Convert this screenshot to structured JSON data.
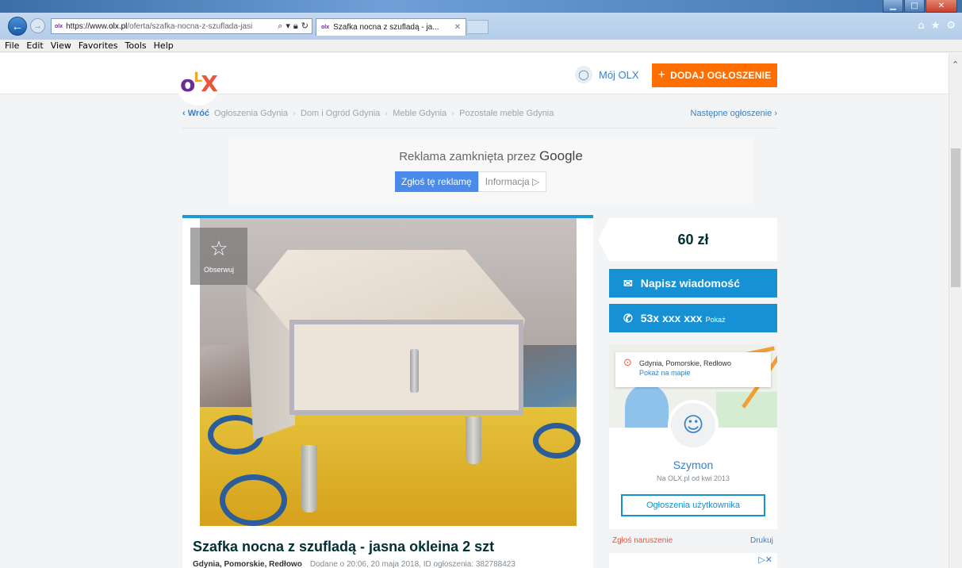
{
  "browser": {
    "url_prefix": "https://www.",
    "url_domain": "olx.pl",
    "url_rest": "/oferta/szafka-nocna-z-szuflada-jasi",
    "tab_title": "Szafka nocna z szufladą - ja...",
    "favicon_text": "olx",
    "menu": [
      "File",
      "Edit",
      "View",
      "Favorites",
      "Tools",
      "Help"
    ]
  },
  "header": {
    "my_olx": "Mój OLX",
    "add_button": "DODAJ OGŁOSZENIE"
  },
  "breadcrumb": {
    "back": "Wróć",
    "items": [
      "Ogłoszenia Gdynia",
      "Dom i Ogród Gdynia",
      "Meble Gdynia",
      "Pozostałe meble Gdynia"
    ],
    "next": "Następne ogłoszenie"
  },
  "ad_closed": {
    "message": "Reklama zamknięta przez",
    "brand": "Google",
    "report_button": "Zgłoś tę reklamę",
    "info_button": "Informacja ▷"
  },
  "listing": {
    "observe": "Obserwuj",
    "title": "Szafka nocna z szufladą - jasna okleina 2 szt",
    "location": "Gdynia, Pomorskie, Redłowo",
    "meta": "Dodane o 20:06, 20 maja 2018, ID ogłoszenia: 382788423"
  },
  "sidebar": {
    "price": "60 zł",
    "message_button": "Napisz wiadomość",
    "phone_number": "53x xxx xxx",
    "phone_show": "Pokaż",
    "map_location": "Gdynia, Pomorskie, Redłowo",
    "map_show": "Pokaż na mapie",
    "seller_name": "Szymon",
    "seller_since": "Na OLX.pl od kwi 2013",
    "user_ads_button": "Ogłoszenia użytkownika",
    "report": "Zgłoś naruszenie",
    "print": "Drukuj"
  },
  "colors": {
    "accent_blue": "#1691d3",
    "add_orange": "#ff6e01",
    "link_blue": "#3b80c4"
  }
}
